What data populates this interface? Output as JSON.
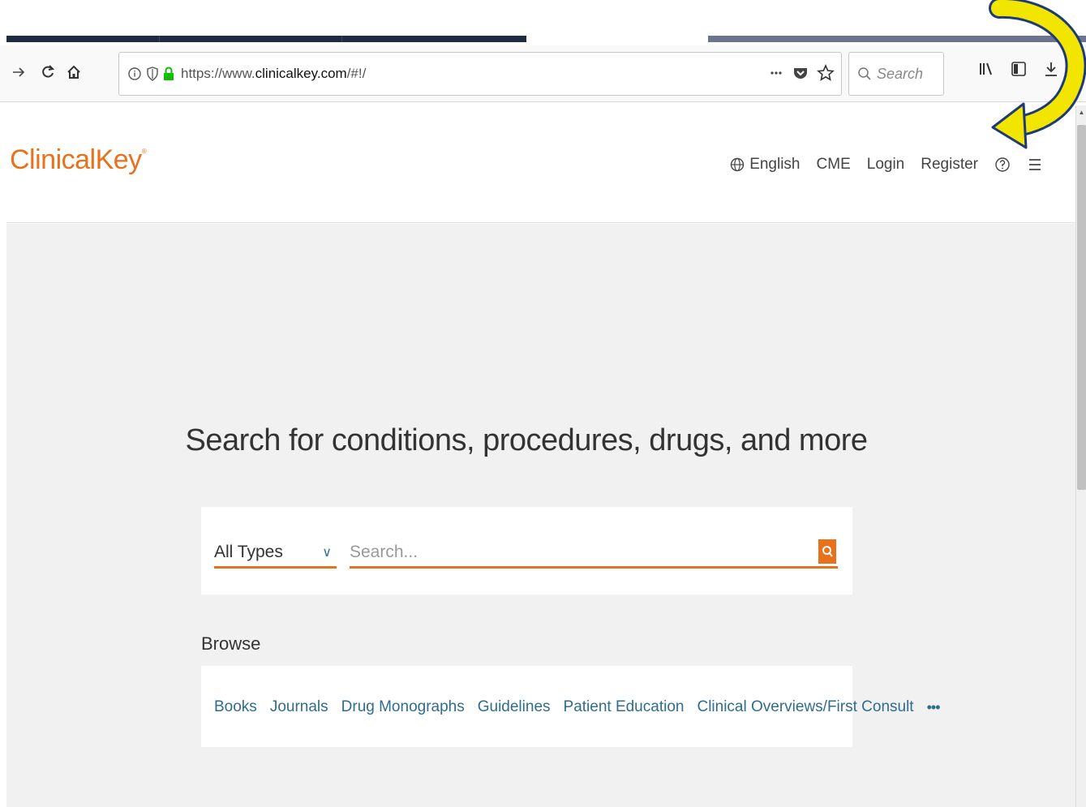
{
  "browser": {
    "url_prefix": "https://www.",
    "url_domain": "clinicalkey.com",
    "url_suffix": "/#!/",
    "search_placeholder": "Search"
  },
  "site": {
    "logo_text": "ClinicalKey",
    "logo_mark": "®",
    "nav": {
      "language": "English",
      "cme": "CME",
      "login": "Login",
      "register": "Register"
    }
  },
  "main": {
    "headline": "Search for conditions, procedures, drugs, and more",
    "type_select": "All Types",
    "search_placeholder": "Search...",
    "browse_label": "Browse",
    "browse_links": [
      "Books",
      "Journals",
      "Drug Monographs",
      "Guidelines",
      "Patient Education",
      "Clinical Overviews/First Consult"
    ],
    "more_label": "•••"
  },
  "colors": {
    "brand": "#e9711c",
    "link": "#2e6d8e",
    "annotation_arrow": "#f2e600"
  }
}
